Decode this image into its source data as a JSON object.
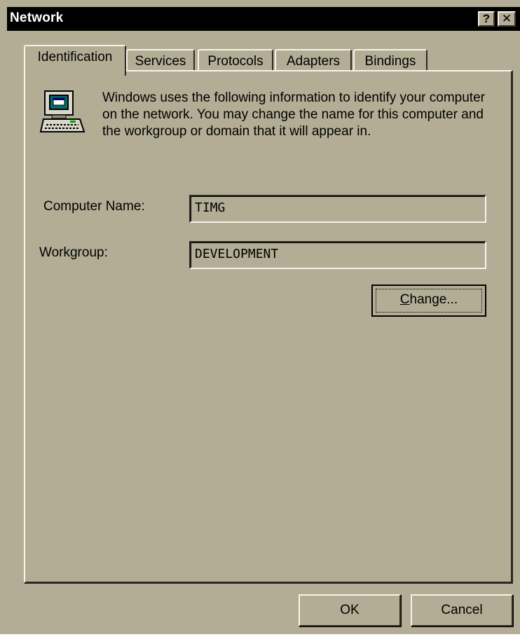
{
  "window": {
    "title": "Network",
    "help_glyph": "?",
    "close_glyph": "✕"
  },
  "tabs": [
    {
      "label": "Identification",
      "active": true
    },
    {
      "label": "Services",
      "active": false
    },
    {
      "label": "Protocols",
      "active": false
    },
    {
      "label": "Adapters",
      "active": false
    },
    {
      "label": "Bindings",
      "active": false
    }
  ],
  "identification": {
    "description": "Windows uses the following information to identify your computer on the network.  You may change the name for this computer and the workgroup or domain that it will appear in.",
    "computer_name_label": "Computer Name:",
    "computer_name_value": "TIMG",
    "workgroup_label": "Workgroup:",
    "workgroup_value": "DEVELOPMENT",
    "change_button": {
      "accel": "C",
      "rest": "hange..."
    }
  },
  "footer": {
    "ok_label": "OK",
    "cancel_label": "Cancel"
  },
  "colors": {
    "face": "#b3ad95",
    "titlebar": "#000000",
    "highlight": "#f6f4ea",
    "shadow": "#2e2c20"
  }
}
